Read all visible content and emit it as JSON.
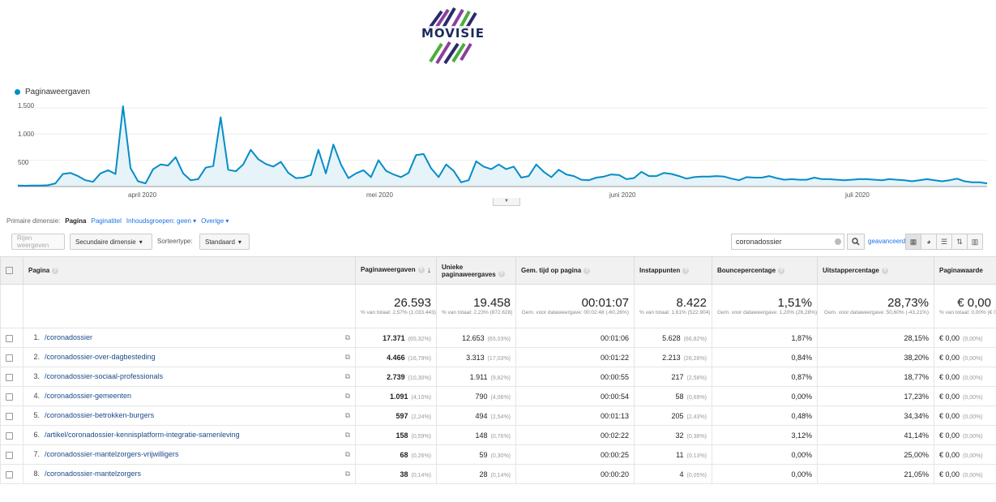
{
  "logo": {
    "text": "MOVISIE"
  },
  "chart_data": {
    "type": "line",
    "series": [
      {
        "name": "Paginaweergaven",
        "values": [
          20,
          15,
          18,
          20,
          25,
          60,
          240,
          260,
          200,
          120,
          90,
          250,
          310,
          240,
          1530,
          350,
          100,
          60,
          330,
          420,
          400,
          560,
          250,
          120,
          140,
          360,
          390,
          1320,
          320,
          290,
          420,
          700,
          520,
          430,
          380,
          470,
          260,
          160,
          170,
          220,
          700,
          250,
          800,
          420,
          160,
          250,
          310,
          180,
          500,
          300,
          230,
          180,
          260,
          600,
          620,
          350,
          180,
          420,
          300,
          80,
          120,
          480,
          380,
          330,
          420,
          330,
          380,
          170,
          200,
          420,
          280,
          180,
          320,
          230,
          200,
          130,
          120,
          170,
          190,
          230,
          220,
          140,
          160,
          280,
          200,
          200,
          260,
          240,
          200,
          150,
          180,
          190,
          190,
          200,
          190,
          150,
          120,
          180,
          170,
          170,
          200,
          160,
          130,
          140,
          130,
          130,
          170,
          140,
          140,
          130,
          120,
          130,
          140,
          140,
          130,
          120,
          140,
          130,
          120,
          100,
          120,
          140,
          120,
          100,
          120,
          150,
          100,
          80,
          80,
          60
        ]
      }
    ],
    "ylim": [
      0,
      1700
    ],
    "y_ticks": [
      "1.500",
      "1.000",
      "500"
    ],
    "x_ticks": [
      "april 2020",
      "mei 2020",
      "juni 2020",
      "juli 2020"
    ],
    "line_color": "#058dc7",
    "fill_color": "#e6f3f9"
  },
  "dimension_bar": {
    "label": "Primaire dimensie:",
    "active": "Pagina",
    "options": [
      "Paginatitel",
      "Inhoudsgroepen: geen ▾",
      "Overige ▾"
    ]
  },
  "toolbar": {
    "plot_rows": "Rijen weergeven",
    "secondary_dimension": "Secundaire dimensie",
    "sort_type_label": "Sorteertype:",
    "sort_type_value": "Standaard",
    "search_value": "coronadossier",
    "advanced": "geavanceerd"
  },
  "table": {
    "headers": {
      "page": "Pagina",
      "pageviews": "Paginaweergaven",
      "unique": "Unieke paginaweergaves",
      "avg_time": "Gem. tijd op pagina",
      "entrances": "Instappunten",
      "bounce": "Bouncepercentage",
      "exit": "Uitstappercentage",
      "value": "Paginawaarde"
    },
    "totals": {
      "pageviews": "26.593",
      "pageviews_sub": "% van totaal: 2,57% (1.033.443)",
      "unique": "19.458",
      "unique_sub": "% van totaal: 2,23% (872.628)",
      "avg_time": "00:01:07",
      "avg_time_sub": "Gem. voor dataweergave: 00:02:48 (-60,26%)",
      "entrances": "8.422",
      "entrances_sub": "% van totaal: 1,61% (522.904)",
      "bounce": "1,51%",
      "bounce_sub": "Gem. voor dataweergave: 1,20% (26,28%)",
      "exit": "28,73%",
      "exit_sub": "Gem. voor dataweergave: 50,60% (-43,21%)",
      "value": "€ 0,00",
      "value_sub": "% van totaal: 0,00% (€ 0,00)"
    },
    "rows": [
      {
        "n": "1.",
        "page": "/coronadossier",
        "pv": "17.371",
        "pv_pct": "(65,32%)",
        "upv": "12.653",
        "upv_pct": "(65,03%)",
        "time": "00:01:06",
        "ent": "5.628",
        "ent_pct": "(66,82%)",
        "bounce": "1,87%",
        "exit": "28,15%",
        "value": "€ 0,00",
        "value_pct": "(0,00%)"
      },
      {
        "n": "2.",
        "page": "/coronadossier-over-dagbesteding",
        "pv": "4.466",
        "pv_pct": "(16,79%)",
        "upv": "3.313",
        "upv_pct": "(17,03%)",
        "time": "00:01:22",
        "ent": "2.213",
        "ent_pct": "(26,28%)",
        "bounce": "0,84%",
        "exit": "38,20%",
        "value": "€ 0,00",
        "value_pct": "(0,00%)"
      },
      {
        "n": "3.",
        "page": "/coronadossier-sociaal-professionals",
        "pv": "2.739",
        "pv_pct": "(10,30%)",
        "upv": "1.911",
        "upv_pct": "(9,82%)",
        "time": "00:00:55",
        "ent": "217",
        "ent_pct": "(2,58%)",
        "bounce": "0,87%",
        "exit": "18,77%",
        "value": "€ 0,00",
        "value_pct": "(0,00%)"
      },
      {
        "n": "4.",
        "page": "/coronadossier-gemeenten",
        "pv": "1.091",
        "pv_pct": "(4,10%)",
        "upv": "790",
        "upv_pct": "(4,06%)",
        "time": "00:00:54",
        "ent": "58",
        "ent_pct": "(0,69%)",
        "bounce": "0,00%",
        "exit": "17,23%",
        "value": "€ 0,00",
        "value_pct": "(0,00%)"
      },
      {
        "n": "5.",
        "page": "/coronadossier-betrokken-burgers",
        "pv": "597",
        "pv_pct": "(2,24%)",
        "upv": "494",
        "upv_pct": "(2,54%)",
        "time": "00:01:13",
        "ent": "205",
        "ent_pct": "(2,43%)",
        "bounce": "0,48%",
        "exit": "34,34%",
        "value": "€ 0,00",
        "value_pct": "(0,00%)"
      },
      {
        "n": "6.",
        "page": "/artikel/coronadossier-kennisplatform-integratie-samenleving",
        "pv": "158",
        "pv_pct": "(0,59%)",
        "upv": "148",
        "upv_pct": "(0,76%)",
        "time": "00:02:22",
        "ent": "32",
        "ent_pct": "(0,38%)",
        "bounce": "3,12%",
        "exit": "41,14%",
        "value": "€ 0,00",
        "value_pct": "(0,00%)"
      },
      {
        "n": "7.",
        "page": "/coronadossier-mantelzorgers-vrijwilligers",
        "pv": "68",
        "pv_pct": "(0,26%)",
        "upv": "59",
        "upv_pct": "(0,30%)",
        "time": "00:00:25",
        "ent": "11",
        "ent_pct": "(0,13%)",
        "bounce": "0,00%",
        "exit": "25,00%",
        "value": "€ 0,00",
        "value_pct": "(0,00%)"
      },
      {
        "n": "8.",
        "page": "/coronadossier-mantelzorgers",
        "pv": "38",
        "pv_pct": "(0,14%)",
        "upv": "28",
        "upv_pct": "(0,14%)",
        "time": "00:00:20",
        "ent": "4",
        "ent_pct": "(0,05%)",
        "bounce": "0,00%",
        "exit": "21,05%",
        "value": "€ 0,00",
        "value_pct": "(0,00%)"
      }
    ]
  }
}
